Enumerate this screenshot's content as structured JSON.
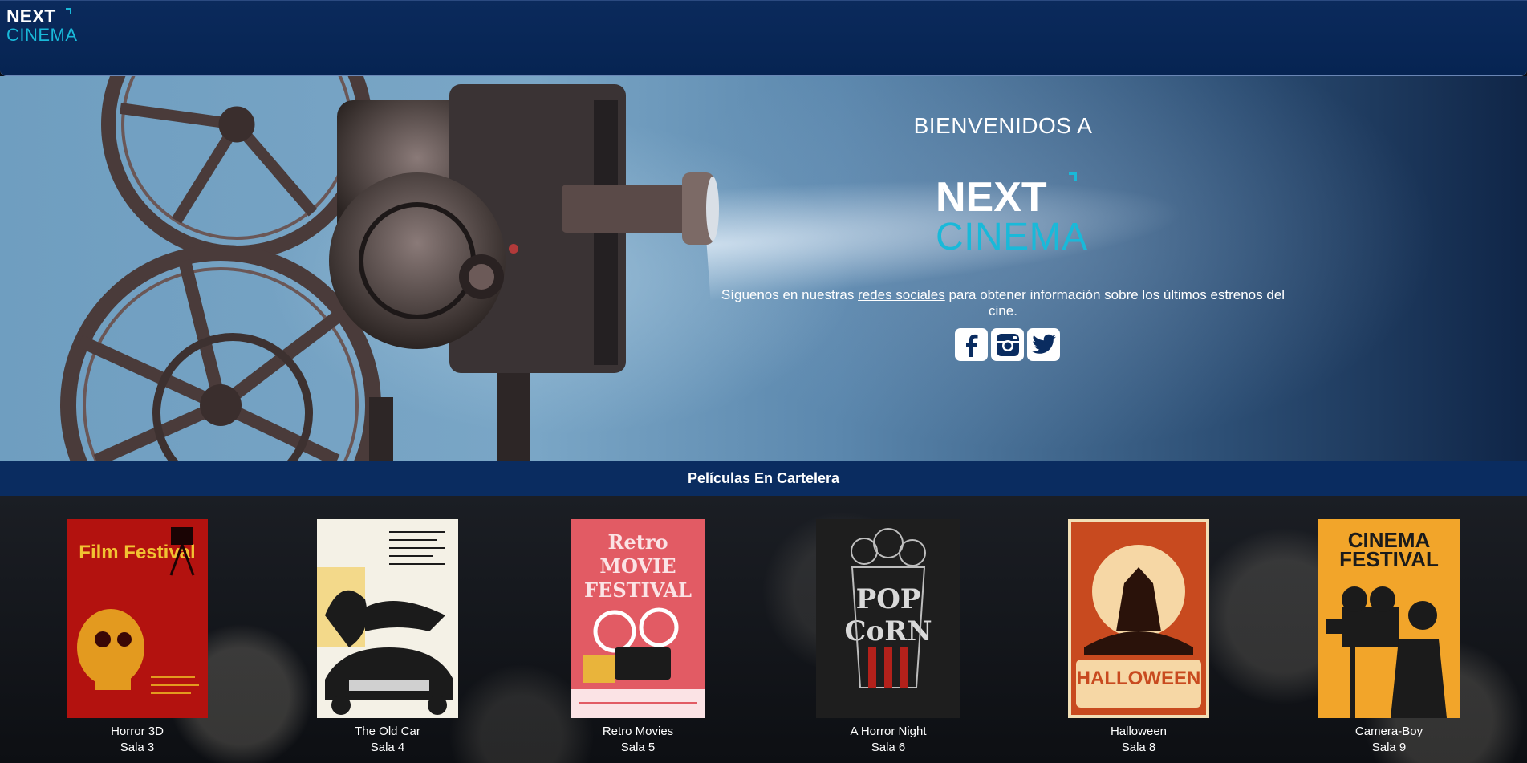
{
  "header": {
    "logo_next": "NEXT",
    "logo_cinema": "CINEMA"
  },
  "hero": {
    "welcome": "BIENVENIDOS A",
    "logo_next": "NEXT",
    "logo_cinema": "CINEMA",
    "tagline_before": "Síguenos en nuestras ",
    "tagline_link": "redes sociales",
    "tagline_after": " para obtener información sobre los últimos estrenos del cine.",
    "socials": [
      {
        "name": "facebook",
        "icon": "facebook-icon"
      },
      {
        "name": "instagram",
        "icon": "instagram-icon"
      },
      {
        "name": "twitter",
        "icon": "twitter-icon"
      }
    ]
  },
  "section": {
    "title": "Películas En Cartelera"
  },
  "movies": [
    {
      "title": "Horror 3D",
      "room": "Sala 3",
      "poster_text": "Film Festival",
      "poster_color": "#b3120f"
    },
    {
      "title": "The Old Car",
      "room": "Sala 4",
      "poster_text": "",
      "poster_color": "#f4f1e6"
    },
    {
      "title": "Retro Movies",
      "room": "Sala 5",
      "poster_text": "Retro MOVIE FESTIVAL",
      "poster_color": "#e25b64"
    },
    {
      "title": "A Horror Night",
      "room": "Sala 6",
      "poster_text": "POP CoRN",
      "poster_color": "#1e1e1e"
    },
    {
      "title": "Halloween",
      "room": "Sala 8",
      "poster_text": "HALLOWEEN",
      "poster_color": "#c84a1f"
    },
    {
      "title": "Camera-Boy",
      "room": "Sala 9",
      "poster_text": "CINEMA FESTIVAL",
      "poster_color": "#f2a52a"
    }
  ],
  "colors": {
    "brand_blue": "#0a2c60",
    "accent_cyan": "#19b9d9"
  }
}
